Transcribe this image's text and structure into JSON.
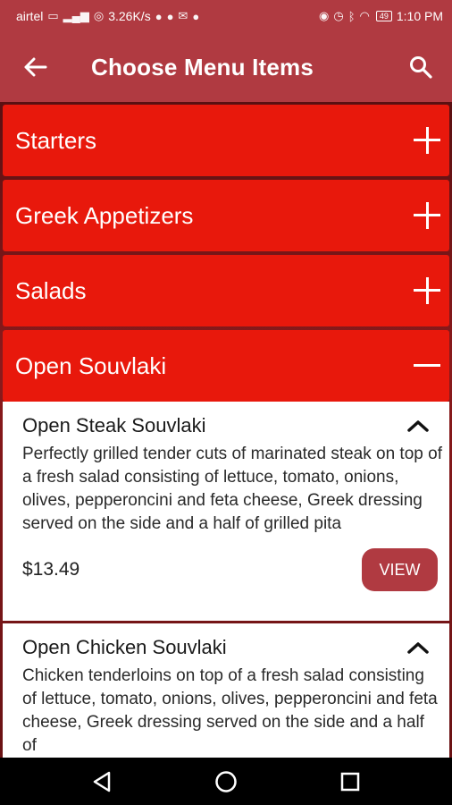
{
  "status_bar": {
    "carrier": "airtel",
    "speed": "3.26K/s",
    "battery": "49",
    "time": "1:10 PM"
  },
  "app_bar": {
    "title": "Choose Menu Items",
    "back_icon": "arrow-left-icon",
    "search_icon": "search-icon"
  },
  "categories": [
    {
      "label": "Starters",
      "state": "collapsed"
    },
    {
      "label": "Greek Appetizers",
      "state": "collapsed"
    },
    {
      "label": "Salads",
      "state": "collapsed"
    },
    {
      "label": "Open Souvlaki",
      "state": "expanded"
    }
  ],
  "items": [
    {
      "name": "Open Steak Souvlaki",
      "description": "Perfectly grilled tender cuts of marinated steak on top of a fresh salad consisting of lettuce, tomato, onions, olives, pepperoncini and feta cheese, Greek dressing served on the side and a half of grilled pita",
      "price": "$13.49",
      "button": "VIEW"
    },
    {
      "name": "Open Chicken Souvlaki",
      "description": "Chicken tenderloins on top of a fresh salad consisting of lettuce, tomato, onions, olives, pepperoncini and feta cheese, Greek dressing served on the side and a half of"
    }
  ],
  "colors": {
    "app_bar": "#b03a41",
    "category": "#e8180c",
    "button": "#b03a41"
  },
  "nav": {
    "back": "triangle-back-icon",
    "home": "circle-home-icon",
    "recents": "square-recents-icon"
  }
}
